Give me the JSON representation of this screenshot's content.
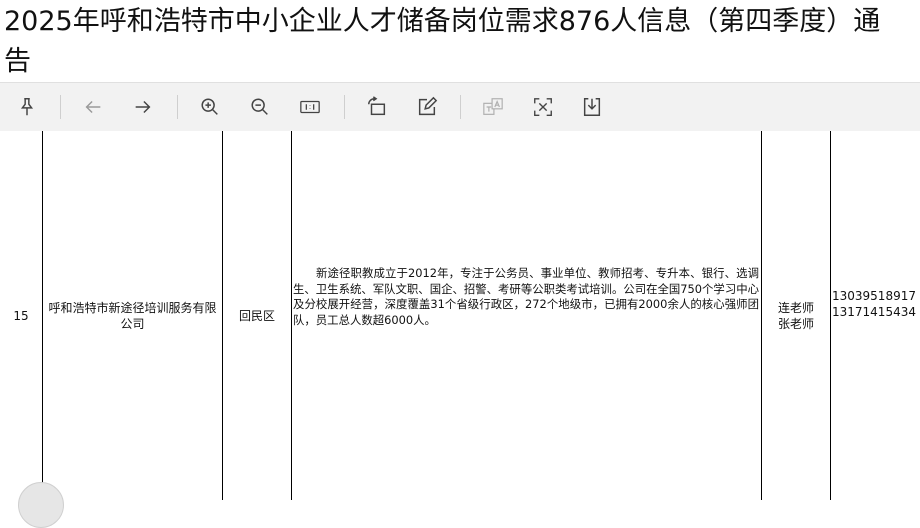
{
  "document": {
    "title": "2025年呼和浩特市中小企业人才储备岗位需求876人信息（第四季度）通告"
  },
  "toolbar": {
    "icons": [
      "pin-icon",
      "back-arrow-icon",
      "forward-arrow-icon",
      "zoom-in-icon",
      "zoom-out-icon",
      "fit-page-icon",
      "rotate-icon",
      "annotate-icon",
      "translate-icon",
      "text-select-icon",
      "download-icon"
    ]
  },
  "row": {
    "index": "15",
    "company": "呼和浩特市新途径培训服务有限公司",
    "district": "回民区",
    "description": "新途径职教成立于2012年，专注于公务员、事业单位、教师招考、专升本、银行、选调生、卫生系统、军队文职、国企、招警、考研等公职类考试培训。公司在全国750个学习中心及分校展开经营，深度覆盖31个省级行政区，272个地级市，已拥有2000余人的核心强师团队，员工总人数超6000人。",
    "contacts": [
      "连老师",
      "张老师"
    ],
    "phones": [
      "13039518917",
      "13171415434"
    ]
  }
}
